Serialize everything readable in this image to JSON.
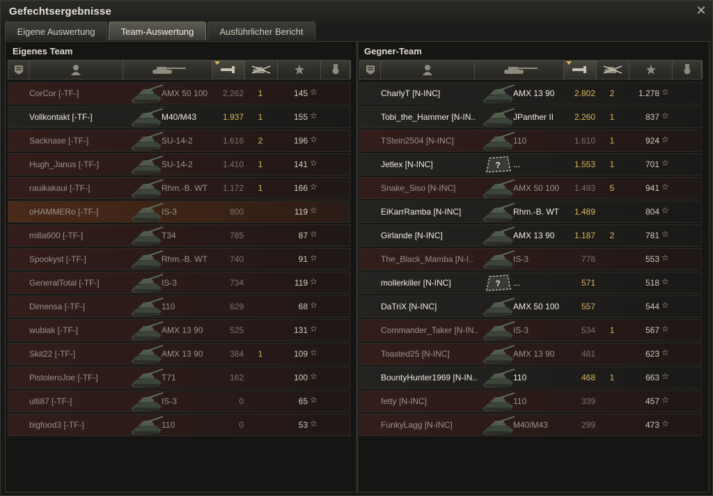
{
  "window": {
    "title": "Gefechtsergebnisse"
  },
  "tabs": [
    {
      "label": "Eigene Auswertung",
      "active": false
    },
    {
      "label": "Team-Auswertung",
      "active": true
    },
    {
      "label": "Ausführlicher Bericht",
      "active": false
    }
  ],
  "columns_icons": [
    "squad-icon",
    "player-icon",
    "tank-icon",
    "damage-icon",
    "kills-icon",
    "xp-star-icon",
    "medal-icon"
  ],
  "own_team": {
    "title": "Eigenes Team",
    "rows": [
      {
        "name": "CorCor [-TF-]",
        "vehicle": "AMX 50 100",
        "damage": "2.262",
        "kills": "1",
        "xp": "145",
        "state": "dead"
      },
      {
        "name": "Vollkontakt [-TF-]",
        "vehicle": "M40/M43",
        "damage": "1.937",
        "kills": "1",
        "xp": "155",
        "state": "alive"
      },
      {
        "name": "Sacknase [-TF-]",
        "vehicle": "SU-14-2",
        "damage": "1.616",
        "kills": "2",
        "xp": "196",
        "state": "dead"
      },
      {
        "name": "Hugh_Janus [-TF-]",
        "vehicle": "SU-14-2",
        "damage": "1.410",
        "kills": "1",
        "xp": "141",
        "state": "dead"
      },
      {
        "name": "rauikakaui [-TF-]",
        "vehicle": "Rhm.-B. WT",
        "damage": "1.172",
        "kills": "1",
        "xp": "166",
        "state": "dead"
      },
      {
        "name": "oHAMMERo [-TF-]",
        "vehicle": "IS-3",
        "damage": "800",
        "kills": "",
        "xp": "119",
        "state": "highlight"
      },
      {
        "name": "milla600 [-TF-]",
        "vehicle": "T34",
        "damage": "785",
        "kills": "",
        "xp": "87",
        "state": "dead"
      },
      {
        "name": "Spookyst [-TF-]",
        "vehicle": "Rhm.-B. WT",
        "damage": "740",
        "kills": "",
        "xp": "91",
        "state": "dead"
      },
      {
        "name": "GeneralTotal [-TF-]",
        "vehicle": "IS-3",
        "damage": "734",
        "kills": "",
        "xp": "119",
        "state": "dead"
      },
      {
        "name": "Dimensa [-TF-]",
        "vehicle": "110",
        "damage": "629",
        "kills": "",
        "xp": "68",
        "state": "dead"
      },
      {
        "name": "wubiak [-TF-]",
        "vehicle": "AMX 13 90",
        "damage": "525",
        "kills": "",
        "xp": "131",
        "state": "dead"
      },
      {
        "name": "Skit22 [-TF-]",
        "vehicle": "AMX 13 90",
        "damage": "384",
        "kills": "1",
        "xp": "109",
        "state": "dead"
      },
      {
        "name": "PistoleroJoe [-TF-]",
        "vehicle": "T71",
        "damage": "162",
        "kills": "",
        "xp": "100",
        "state": "dead"
      },
      {
        "name": "ulti87 [-TF-]",
        "vehicle": "IS-3",
        "damage": "0",
        "kills": "",
        "xp": "65",
        "state": "dead"
      },
      {
        "name": "bigfood3 [-TF-]",
        "vehicle": "110",
        "damage": "0",
        "kills": "",
        "xp": "53",
        "state": "dead"
      }
    ]
  },
  "enemy_team": {
    "title": "Gegner-Team",
    "rows": [
      {
        "name": "CharlyT [N-INC]",
        "vehicle": "AMX 13 90",
        "damage": "2.802",
        "kills": "2",
        "xp": "1.278",
        "state": "alive"
      },
      {
        "name": "Tobi_the_Hammer [N-IN..",
        "vehicle": "JPanther II",
        "damage": "2.260",
        "kills": "1",
        "xp": "837",
        "state": "alive"
      },
      {
        "name": "TStein2504 [N-INC]",
        "vehicle": "110",
        "damage": "1.610",
        "kills": "1",
        "xp": "924",
        "state": "dead"
      },
      {
        "name": "Jetlex [N-INC]",
        "vehicle": "...",
        "damage": "1.553",
        "kills": "1",
        "xp": "701",
        "state": "alive"
      },
      {
        "name": "Snake_Siso [N-INC]",
        "vehicle": "AMX 50 100",
        "damage": "1.493",
        "kills": "5",
        "xp": "941",
        "state": "dead"
      },
      {
        "name": "EiKarrRamba [N-INC]",
        "vehicle": "Rhm.-B. WT",
        "damage": "1.489",
        "kills": "",
        "xp": "804",
        "state": "alive"
      },
      {
        "name": "Girlande [N-INC]",
        "vehicle": "AMX 13 90",
        "damage": "1.187",
        "kills": "2",
        "xp": "781",
        "state": "alive"
      },
      {
        "name": "The_Black_Mamba [N-I..",
        "vehicle": "IS-3",
        "damage": "778",
        "kills": "",
        "xp": "553",
        "state": "dead"
      },
      {
        "name": "mollerkiller [N-INC]",
        "vehicle": "...",
        "damage": "571",
        "kills": "",
        "xp": "518",
        "state": "alive"
      },
      {
        "name": "DaTriX [N-INC]",
        "vehicle": "AMX 50 100",
        "damage": "557",
        "kills": "",
        "xp": "544",
        "state": "alive"
      },
      {
        "name": "Commander_Taker [N-IN..",
        "vehicle": "IS-3",
        "damage": "534",
        "kills": "1",
        "xp": "567",
        "state": "dead"
      },
      {
        "name": "Toasted25 [N-INC]",
        "vehicle": "AMX 13 90",
        "damage": "481",
        "kills": "",
        "xp": "623",
        "state": "dead"
      },
      {
        "name": "BountyHunter1969 [N-IN..",
        "vehicle": "110",
        "damage": "468",
        "kills": "1",
        "xp": "663",
        "state": "alive"
      },
      {
        "name": "fetty [N-INC]",
        "vehicle": "110",
        "damage": "339",
        "kills": "",
        "xp": "457",
        "state": "dead"
      },
      {
        "name": "FunkyLagg [N-INC]",
        "vehicle": "M40/M43",
        "damage": "299",
        "kills": "",
        "xp": "473",
        "state": "dead"
      }
    ]
  },
  "colors": {
    "gold": "#d8b85a",
    "alive_text": "#f1ede1",
    "dead_text": "#9a9486"
  }
}
